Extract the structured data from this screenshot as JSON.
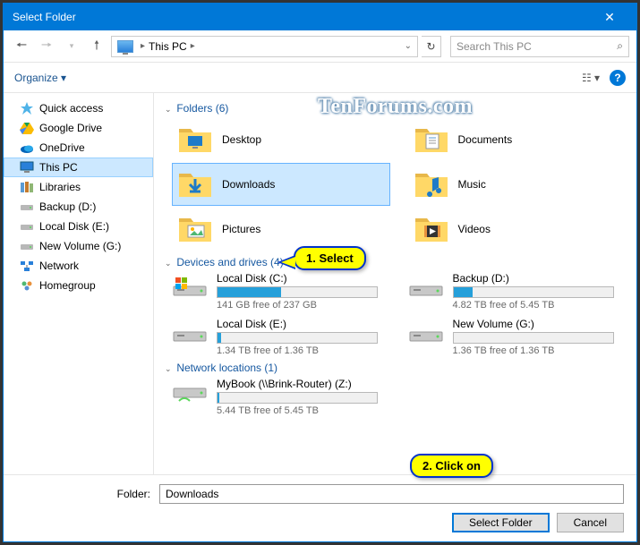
{
  "window": {
    "title": "Select Folder"
  },
  "nav": {
    "location": "This PC",
    "search_placeholder": "Search This PC"
  },
  "toolbar": {
    "organize": "Organize ▾"
  },
  "sidebar": {
    "items": [
      {
        "label": "Quick access",
        "icon": "star"
      },
      {
        "label": "Google Drive",
        "icon": "gdrive"
      },
      {
        "label": "OneDrive",
        "icon": "onedrive"
      },
      {
        "label": "This PC",
        "icon": "pc",
        "selected": true
      },
      {
        "label": "Libraries",
        "icon": "libraries"
      },
      {
        "label": "Backup (D:)",
        "icon": "drive"
      },
      {
        "label": "Local Disk (E:)",
        "icon": "drive"
      },
      {
        "label": "New Volume (G:)",
        "icon": "drive"
      },
      {
        "label": "Network",
        "icon": "network"
      },
      {
        "label": "Homegroup",
        "icon": "homegroup"
      }
    ]
  },
  "sections": {
    "folders": {
      "title": "Folders (6)"
    },
    "drives": {
      "title": "Devices and drives (4)"
    },
    "network": {
      "title": "Network locations (1)"
    }
  },
  "folders": [
    {
      "name": "Desktop",
      "type": "desktop"
    },
    {
      "name": "Documents",
      "type": "documents"
    },
    {
      "name": "Downloads",
      "type": "downloads",
      "selected": true
    },
    {
      "name": "Music",
      "type": "music"
    },
    {
      "name": "Pictures",
      "type": "pictures"
    },
    {
      "name": "Videos",
      "type": "videos"
    }
  ],
  "drives": [
    {
      "name": "Local Disk (C:)",
      "free": "141 GB free of 237 GB",
      "pct": 40,
      "os": true
    },
    {
      "name": "Backup (D:)",
      "free": "4.82 TB free of 5.45 TB",
      "pct": 12
    },
    {
      "name": "Local Disk (E:)",
      "free": "1.34 TB free of 1.36 TB",
      "pct": 2
    },
    {
      "name": "New Volume (G:)",
      "free": "1.36 TB free of 1.36 TB",
      "pct": 0
    }
  ],
  "netlocs": [
    {
      "name": "MyBook (\\\\Brink-Router) (Z:)",
      "free": "5.44 TB free of 5.45 TB",
      "pct": 1
    }
  ],
  "footer": {
    "folder_label": "Folder:",
    "folder_value": "Downloads",
    "select": "Select Folder",
    "cancel": "Cancel"
  },
  "watermark": "TenForums.com",
  "callouts": {
    "c1": "1. Select",
    "c2": "2. Click on"
  }
}
